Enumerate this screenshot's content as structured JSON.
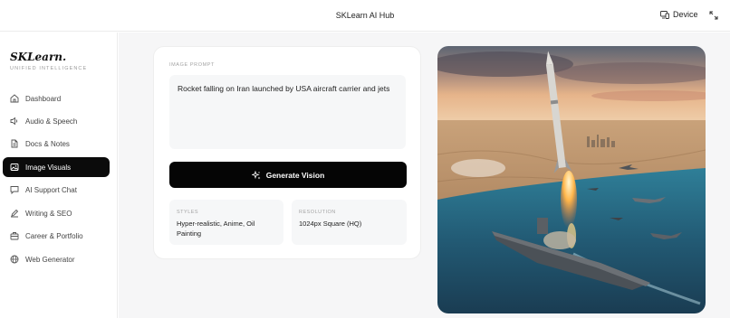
{
  "header": {
    "title": "SKLearn AI Hub",
    "device_label": "Device",
    "device_icon": "monitor-phone-icon",
    "expand_icon": "expand-arrows-icon"
  },
  "sidebar": {
    "brand": "SKLearn.",
    "tagline": "UNIFIED INTELLIGENCE",
    "items": [
      {
        "label": "Dashboard",
        "icon": "home-icon",
        "active": false
      },
      {
        "label": "Audio & Speech",
        "icon": "speaker-icon",
        "active": false
      },
      {
        "label": "Docs & Notes",
        "icon": "document-icon",
        "active": false
      },
      {
        "label": "Image Visuals",
        "icon": "image-icon",
        "active": true
      },
      {
        "label": "AI Support Chat",
        "icon": "chat-icon",
        "active": false
      },
      {
        "label": "Writing & SEO",
        "icon": "pen-icon",
        "active": false
      },
      {
        "label": "Career & Portfolio",
        "icon": "briefcase-icon",
        "active": false
      },
      {
        "label": "Web Generator",
        "icon": "globe-icon",
        "active": false
      }
    ]
  },
  "form": {
    "prompt_label": "IMAGE PROMPT",
    "prompt_value": "Rocket falling on Iran launched by USA aircraft carrier and jets",
    "generate_label": "Generate Vision",
    "styles_label": "STYLES",
    "styles_value": "Hyper-realistic, Anime, Oil Painting",
    "resolution_label": "RESOLUTION",
    "resolution_value": "1024px Square (HQ)"
  },
  "colors": {
    "accent": "#0b0b0b",
    "panel_bg": "#f6f6f7",
    "field_bg": "#f6f7f8"
  }
}
